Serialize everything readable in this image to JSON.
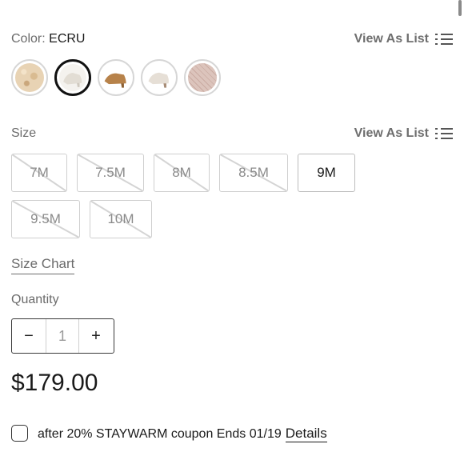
{
  "color": {
    "label": "Color:",
    "value": "ECRU",
    "view_list_label": "View As List",
    "swatches": [
      {
        "name": "beige-snake",
        "color": "#e6cfb1",
        "selected": false
      },
      {
        "name": "ecru",
        "color": "#ece8e1",
        "selected": true
      },
      {
        "name": "cognac",
        "color": "#b27d45",
        "selected": false
      },
      {
        "name": "bone",
        "color": "#e3dbd2",
        "selected": false
      },
      {
        "name": "blush-woven",
        "color": "#d9c0b8",
        "selected": false
      }
    ]
  },
  "size": {
    "label": "Size",
    "view_list_label": "View As List",
    "options": [
      {
        "label": "7M",
        "available": false
      },
      {
        "label": "7.5M",
        "available": false
      },
      {
        "label": "8M",
        "available": false
      },
      {
        "label": "8.5M",
        "available": false
      },
      {
        "label": "9M",
        "available": true
      },
      {
        "label": "9.5M",
        "available": false
      },
      {
        "label": "10M",
        "available": false
      }
    ],
    "chart_link": "Size Chart"
  },
  "quantity": {
    "label": "Quantity",
    "decrement": "−",
    "value": "1",
    "increment": "+"
  },
  "price": "$179.00",
  "coupon": {
    "text": "after 20% STAYWARM coupon Ends 01/19",
    "details_link": "Details"
  }
}
